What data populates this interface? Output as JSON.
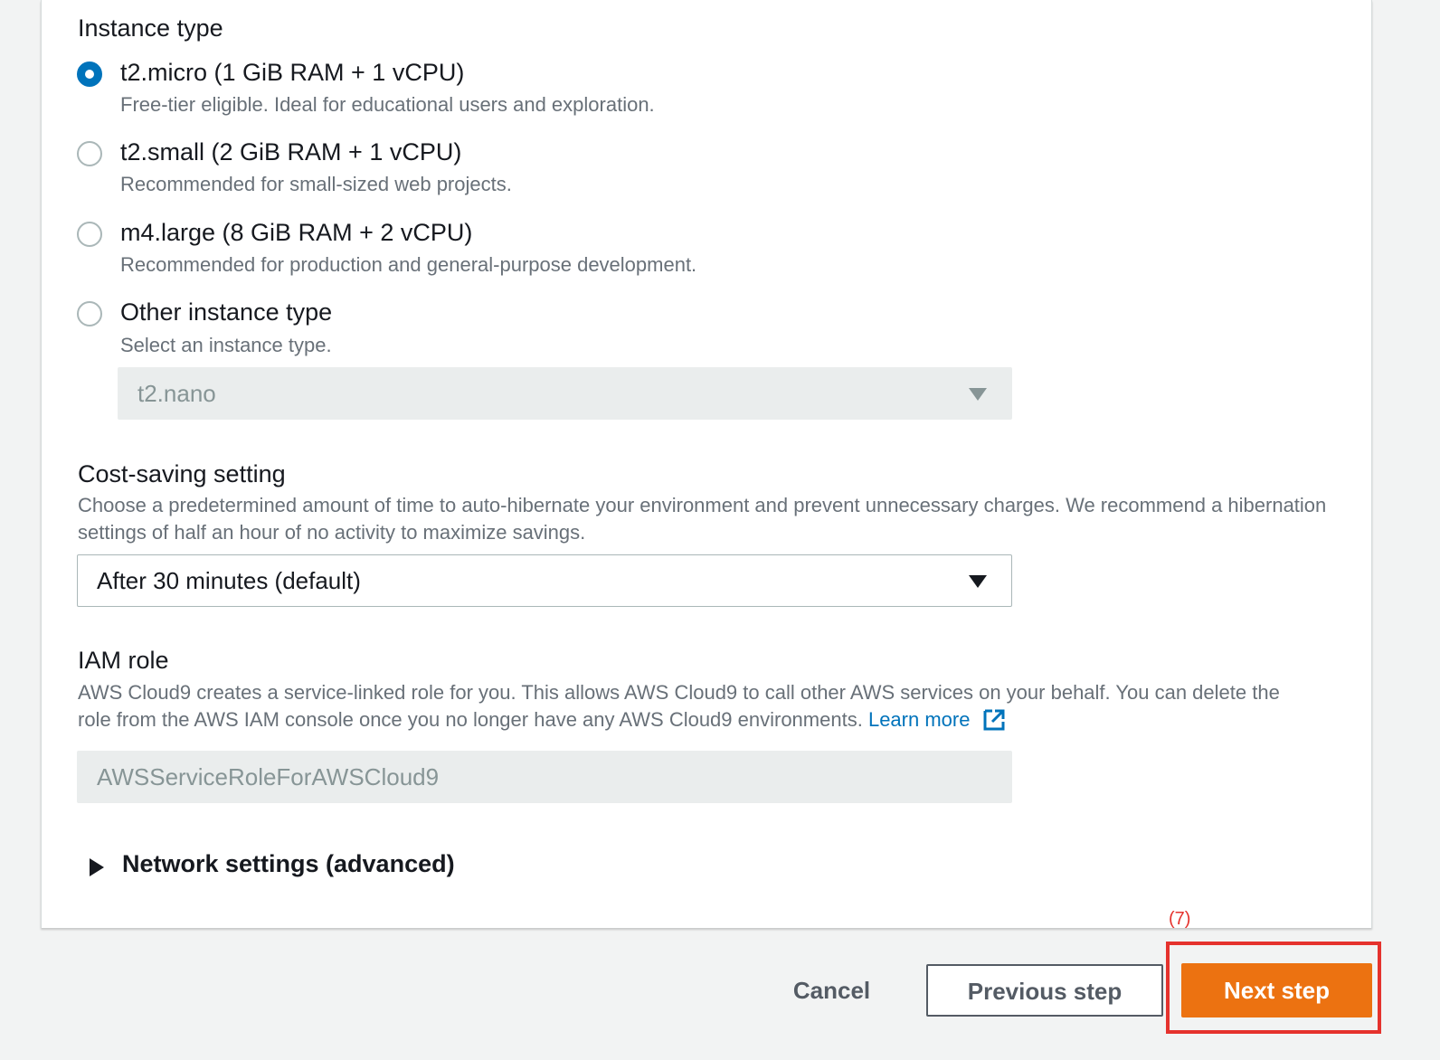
{
  "instance_type": {
    "label": "Instance type",
    "options": [
      {
        "title": "t2.micro (1 GiB RAM + 1 vCPU)",
        "description": "Free-tier eligible. Ideal for educational users and exploration.",
        "selected": true
      },
      {
        "title": "t2.small (2 GiB RAM + 1 vCPU)",
        "description": "Recommended for small-sized web projects.",
        "selected": false
      },
      {
        "title": "m4.large (8 GiB RAM + 2 vCPU)",
        "description": "Recommended for production and general-purpose development.",
        "selected": false
      },
      {
        "title": "Other instance type",
        "description": "Select an instance type.",
        "selected": false
      }
    ],
    "other_select": {
      "value": "t2.nano",
      "disabled": true
    }
  },
  "cost_saving": {
    "label": "Cost-saving setting",
    "description": "Choose a predetermined amount of time to auto-hibernate your environment and prevent unnecessary charges. We recommend a hibernation settings of half an hour of no activity to maximize savings.",
    "select_value": "After 30 minutes (default)"
  },
  "iam_role": {
    "label": "IAM role",
    "description": "AWS Cloud9 creates a service-linked role for you. This allows AWS Cloud9 to call other AWS services on your behalf. You can delete the role from the AWS IAM console once you no longer have any AWS Cloud9 environments.",
    "learn_more": "Learn more",
    "value": "AWSServiceRoleForAWSCloud9"
  },
  "network_settings": {
    "label": "Network settings (advanced)"
  },
  "footer": {
    "cancel": "Cancel",
    "previous": "Previous step",
    "next": "Next step",
    "annotation": "(7)"
  },
  "colors": {
    "primary": "#ec7211",
    "link": "#0073bb",
    "annotation": "#e5322d"
  },
  "icons": {
    "external_link": "external-link-icon",
    "expand": "caret-right-icon",
    "dropdown": "caret-down-icon"
  }
}
